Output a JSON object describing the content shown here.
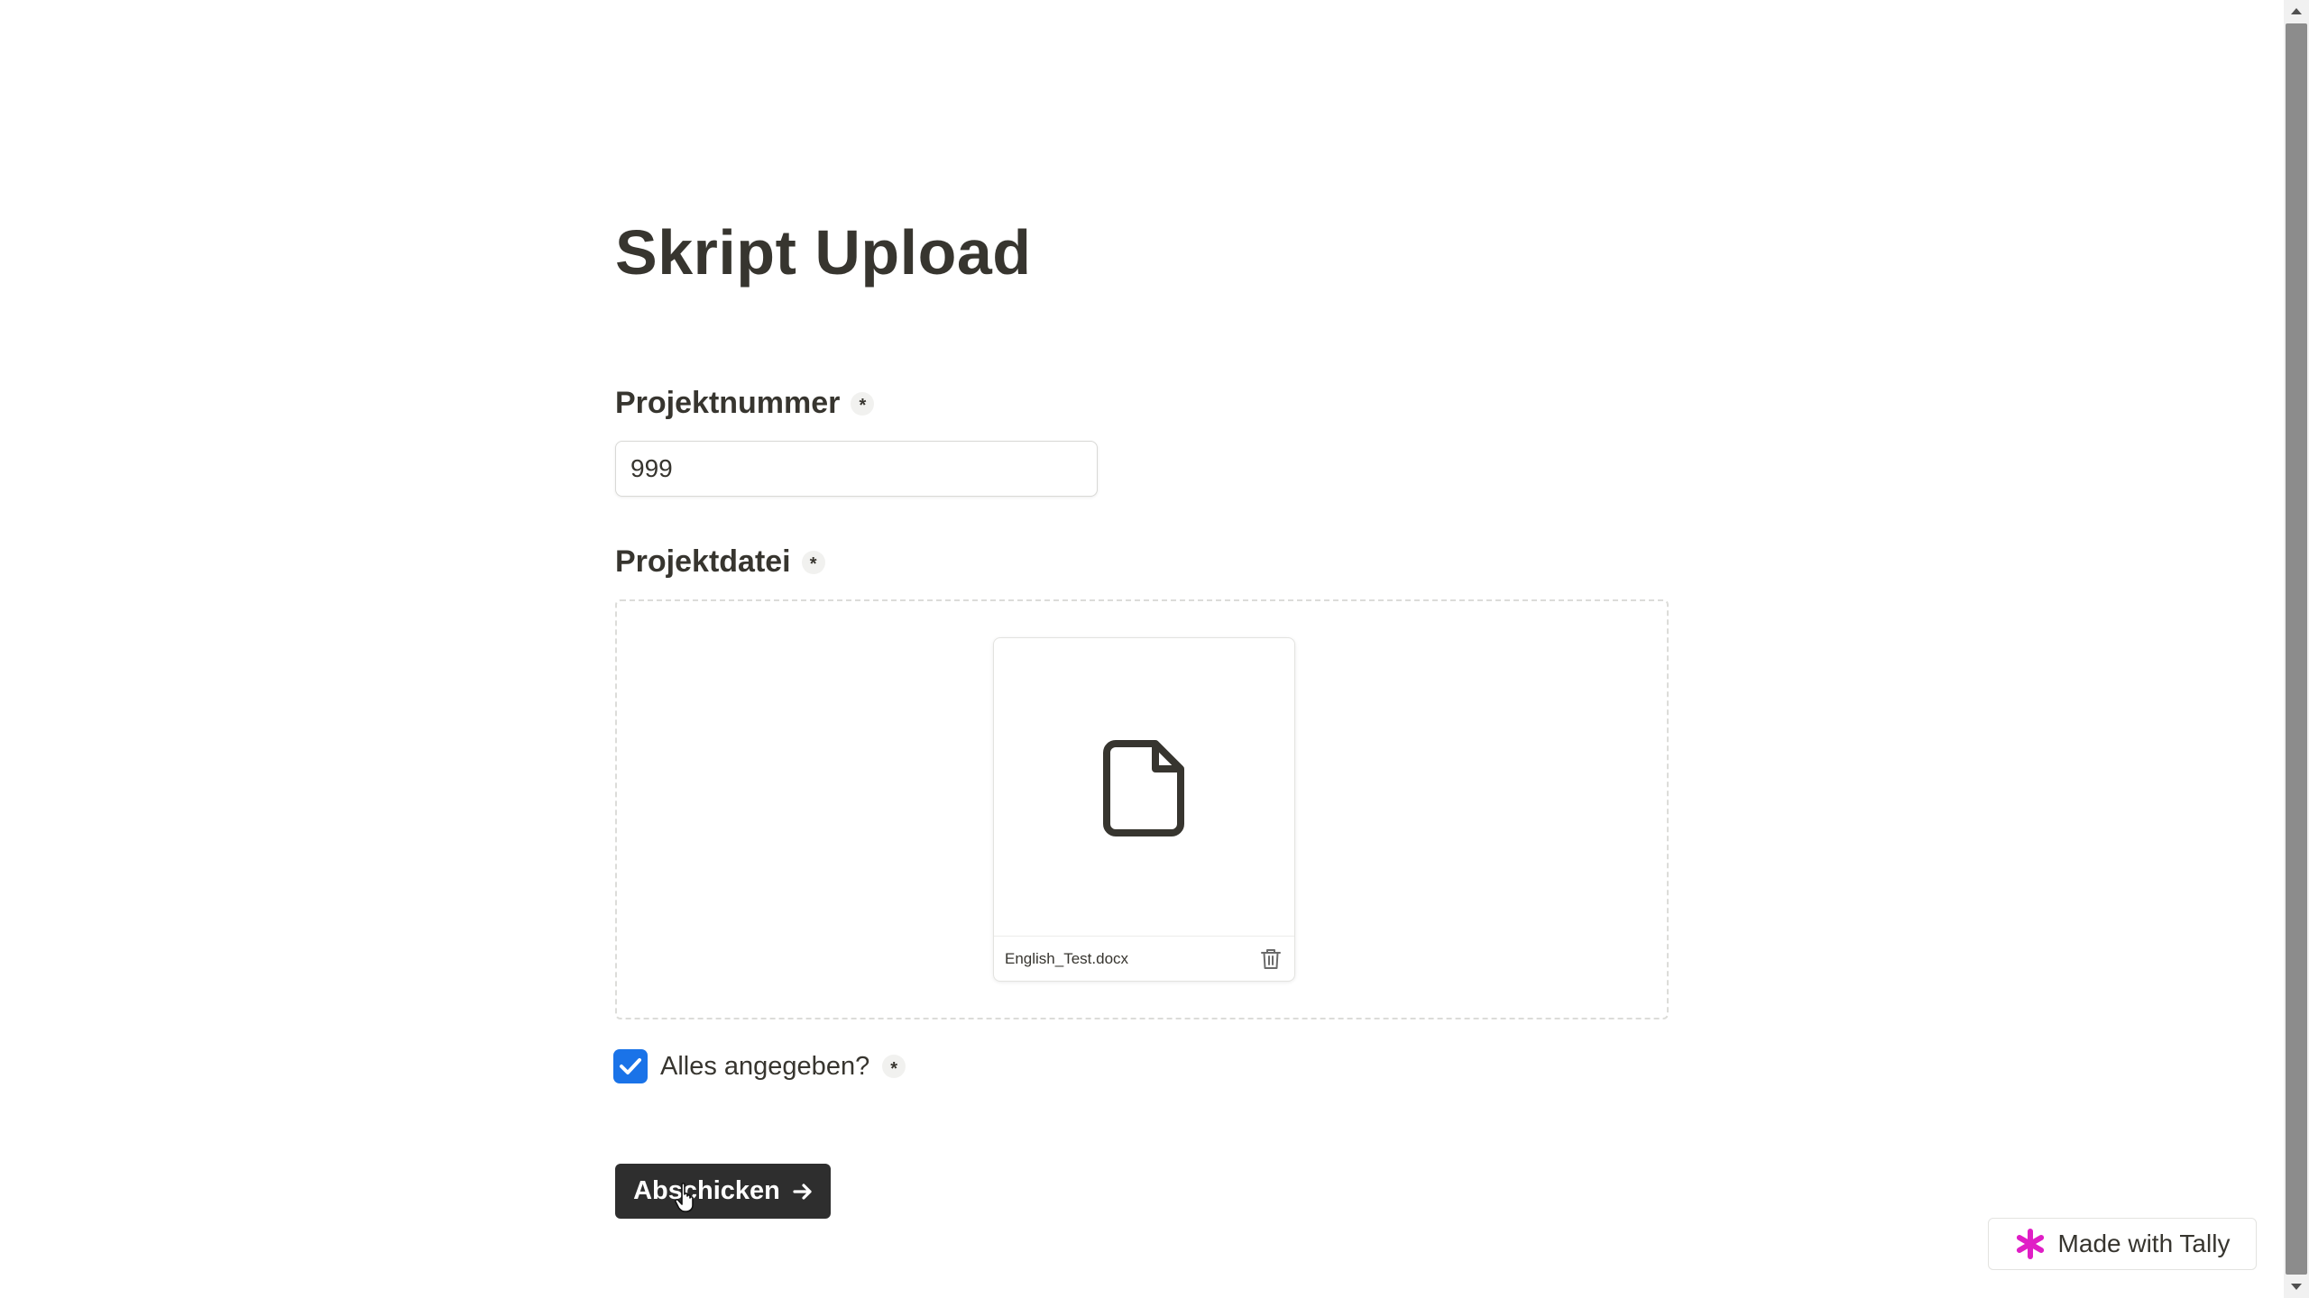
{
  "form": {
    "title": "Skript Upload",
    "project_number": {
      "label": "Projektnummer",
      "required_mark": "*",
      "value": "999"
    },
    "project_file": {
      "label": "Projektdatei",
      "required_mark": "*",
      "file_name": "English_Test.docx",
      "icons": [
        "document-icon",
        "trash-icon"
      ]
    },
    "confirm": {
      "label": "Alles angegeben?",
      "required_mark": "*",
      "checked": true
    },
    "submit": {
      "label": "Abschicken",
      "icon": "arrow-right-icon"
    }
  },
  "badge": {
    "label": "Made with Tally",
    "icon": "tally-asterisk-icon",
    "icon_color": "#e01ec6"
  },
  "colors": {
    "text": "#37352f",
    "checkbox": "#1a73e8",
    "button_bg": "#2e2e2e"
  }
}
